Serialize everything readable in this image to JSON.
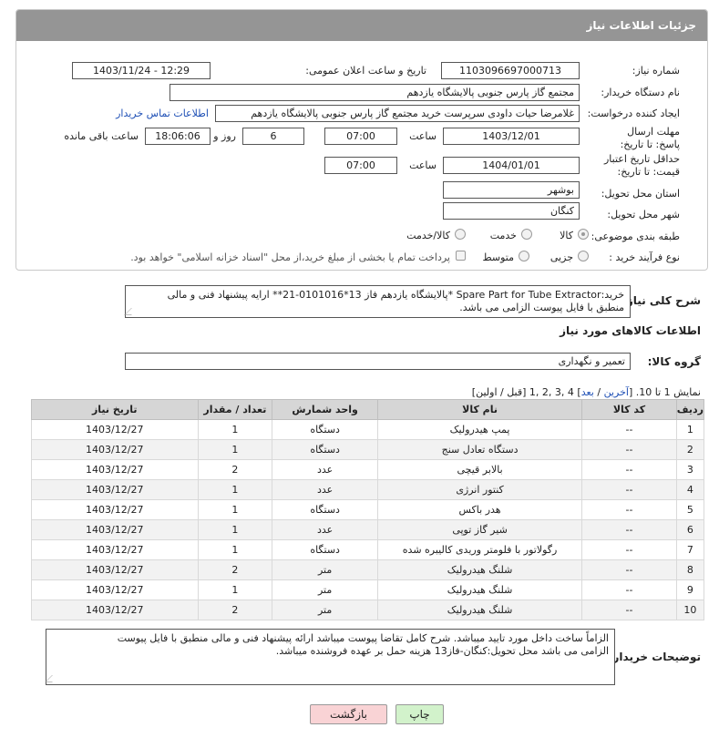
{
  "header": {
    "title": "جزئیات اطلاعات نیاز"
  },
  "fields": {
    "need_number": {
      "label": "شماره نیاز:",
      "value": "1103096697000713"
    },
    "announce_datetime": {
      "label": "تاریخ و ساعت اعلان عمومی:",
      "value": "1403/11/24 - 12:29"
    },
    "buyer_org": {
      "label": "نام دستگاه خریدار:",
      "value": "مجتمع گاز پارس جنوبی  پالایشگاه یازدهم"
    },
    "requester": {
      "label": "ایجاد کننده درخواست:",
      "value": "غلامرضا حیات داودی سرپرست خرید مجتمع گاز پارس جنوبی  پالایشگاه یازدهم",
      "link": "اطلاعات تماس خریدار"
    },
    "reply_deadline": {
      "label": "مهلت ارسال پاسخ: تا تاریخ:",
      "date": "1403/12/01",
      "time_label": "ساعت",
      "time": "07:00",
      "days": "6",
      "days_label": "روز و",
      "remaining": "18:06:06",
      "remaining_label": "ساعت باقی مانده"
    },
    "price_validity": {
      "label": "حداقل تاریخ اعتبار قیمت: تا تاریخ:",
      "date": "1404/01/01",
      "time_label": "ساعت",
      "time": "07:00"
    },
    "province": {
      "label": "استان محل تحویل:",
      "value": "بوشهر"
    },
    "city": {
      "label": "شهر محل تحویل:",
      "value": "کنگان"
    },
    "category": {
      "label": "طبقه بندی موضوعی:",
      "options": [
        "کالا",
        "خدمت",
        "کالا/خدمت"
      ],
      "selected": "کالا"
    },
    "process_type": {
      "label": "نوع فرآیند خرید :",
      "options": [
        "جزیی",
        "متوسط"
      ],
      "selected": "",
      "note": "پرداخت تمام یا بخشی از مبلغ خرید،از محل \"اسناد خزانه اسلامی\" خواهد بود."
    }
  },
  "description": {
    "label": "شرح کلی نیاز:",
    "line1": "خرید:Spare Part for Tube Extractor *پالایشگاه یازدهم فاز 13*0101016-21** ارایه پیشنهاد فنی و مالی",
    "line2": "منطبق با فایل پیوست الزامی می باشد."
  },
  "goods_info_title": "اطلاعات کالاهای مورد نیاز",
  "goods_group": {
    "label": "گروه کالا:",
    "value": "تعمیر و نگهداری"
  },
  "pagination": {
    "text_prefix": "نمایش 1 تا 10. [",
    "last": "آخرین",
    "sep1": " / ",
    "next": "بعد",
    "pages_text": "] 4 ,3 ,2 ,1 [قبل / اولین]"
  },
  "table": {
    "headers": [
      "ردیف",
      "کد کالا",
      "نام کالا",
      "واحد شمارش",
      "تعداد / مقدار",
      "تاریخ نیاز"
    ],
    "rows": [
      [
        "1",
        "--",
        "پمپ هیدرولیک",
        "دستگاه",
        "1",
        "1403/12/27"
      ],
      [
        "2",
        "--",
        "دستگاه تعادل سنج",
        "دستگاه",
        "1",
        "1403/12/27"
      ],
      [
        "3",
        "--",
        "بالابر قیچی",
        "عدد",
        "2",
        "1403/12/27"
      ],
      [
        "4",
        "--",
        "کنتور انرژی",
        "عدد",
        "1",
        "1403/12/27"
      ],
      [
        "5",
        "--",
        "هدر باکس",
        "دستگاه",
        "1",
        "1403/12/27"
      ],
      [
        "6",
        "--",
        "شیر گاز توپی",
        "عدد",
        "1",
        "1403/12/27"
      ],
      [
        "7",
        "--",
        "رگولاتور با فلومتر وریدی کالیبره شده",
        "دستگاه",
        "1",
        "1403/12/27"
      ],
      [
        "8",
        "--",
        "شلنگ هیدرولیک",
        "متر",
        "2",
        "1403/12/27"
      ],
      [
        "9",
        "--",
        "شلنگ هیدرولیک",
        "متر",
        "1",
        "1403/12/27"
      ],
      [
        "10",
        "--",
        "شلنگ هیدرولیک",
        "متر",
        "2",
        "1403/12/27"
      ]
    ]
  },
  "buyer_notes": {
    "label": "توضیحات خریدار:",
    "line1": "الزاماً ساخت داخل مورد تایید میباشد. شرح کامل تقاضا پیوست میباشد ارائه پیشنهاد فنی و مالی منطبق با فایل پیوست",
    "line2": "الزامی می باشد محل تحویل:کنگان-فاز13 هزینه حمل بر عهده فروشنده میباشد."
  },
  "buttons": {
    "print": "چاپ",
    "back": "بازگشت"
  }
}
